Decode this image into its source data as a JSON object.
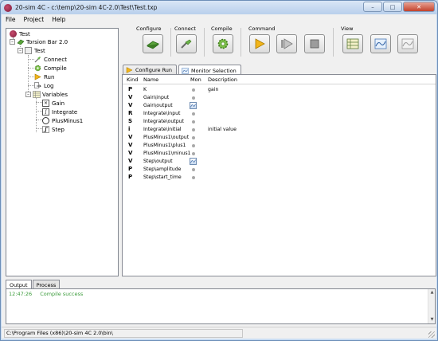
{
  "window": {
    "title": "20-sim 4C - c:\\temp\\20-sim 4C-2.0\\Test\\Test.txp"
  },
  "menu": {
    "file": "File",
    "project": "Project",
    "help": "Help"
  },
  "tree": {
    "root": "Test",
    "target": "Torsion Bar 2.0",
    "model": "Test",
    "connect": "Connect",
    "compile": "Compile",
    "run": "Run",
    "log": "Log",
    "variables": "Variables",
    "gain": "Gain",
    "integrate": "Integrate",
    "plusminus": "PlusMinus1",
    "step": "Step"
  },
  "toolbar": {
    "configure": "Configure",
    "connect": "Connect",
    "compile": "Compile",
    "command": "Command",
    "view": "View"
  },
  "tabs": {
    "configure_run": "Configure Run",
    "monitor_selection": "Monitor Selection"
  },
  "table": {
    "headers": {
      "kind": "Kind",
      "name": "Name",
      "mon": "Mon",
      "description": "Description"
    },
    "rows": [
      {
        "kind": "P",
        "name": "K",
        "mon": "dot",
        "desc": "gain"
      },
      {
        "kind": "V",
        "name": "Gain\\input",
        "mon": "dot",
        "desc": ""
      },
      {
        "kind": "V",
        "name": "Gain\\output",
        "mon": "icon",
        "desc": ""
      },
      {
        "kind": "R",
        "name": "Integrate\\input",
        "mon": "dot",
        "desc": ""
      },
      {
        "kind": "S",
        "name": "Integrate\\output",
        "mon": "dot",
        "desc": ""
      },
      {
        "kind": "i",
        "name": "Integrate\\initial",
        "mon": "dot",
        "desc": "initial value"
      },
      {
        "kind": "V",
        "name": "PlusMinus1\\output",
        "mon": "dot",
        "desc": ""
      },
      {
        "kind": "V",
        "name": "PlusMinus1\\plus1",
        "mon": "dot",
        "desc": ""
      },
      {
        "kind": "V",
        "name": "PlusMinus1\\minus1",
        "mon": "dot",
        "desc": ""
      },
      {
        "kind": "V",
        "name": "Step\\output",
        "mon": "icon",
        "desc": ""
      },
      {
        "kind": "P",
        "name": "Step\\amplitude",
        "mon": "dot",
        "desc": ""
      },
      {
        "kind": "P",
        "name": "Step\\start_time",
        "mon": "dot",
        "desc": ""
      }
    ]
  },
  "output": {
    "tabs": {
      "output": "Output",
      "process": "Process"
    },
    "time": "12:47:26",
    "message": "Compile success"
  },
  "status": {
    "path": "C:\\Program Files (x86)\\20-sim 4C 2.0\\bin\\"
  },
  "colors": {
    "success": "#3a9b3a",
    "accent": "#4a7ab8"
  }
}
